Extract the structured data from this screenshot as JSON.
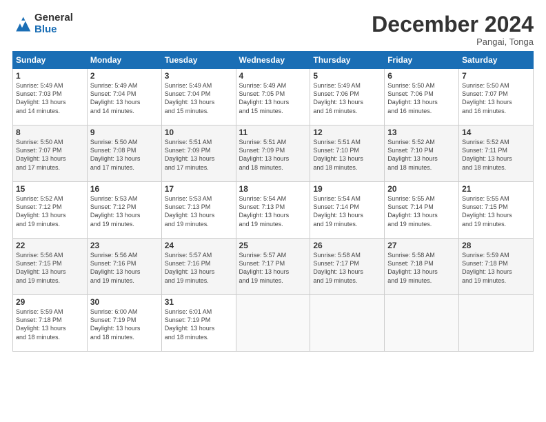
{
  "logo": {
    "general": "General",
    "blue": "Blue"
  },
  "title": "December 2024",
  "location": "Pangai, Tonga",
  "days_of_week": [
    "Sunday",
    "Monday",
    "Tuesday",
    "Wednesday",
    "Thursday",
    "Friday",
    "Saturday"
  ],
  "weeks": [
    [
      {
        "day": "1",
        "info": "Sunrise: 5:49 AM\nSunset: 7:03 PM\nDaylight: 13 hours\nand 14 minutes."
      },
      {
        "day": "2",
        "info": "Sunrise: 5:49 AM\nSunset: 7:04 PM\nDaylight: 13 hours\nand 14 minutes."
      },
      {
        "day": "3",
        "info": "Sunrise: 5:49 AM\nSunset: 7:04 PM\nDaylight: 13 hours\nand 15 minutes."
      },
      {
        "day": "4",
        "info": "Sunrise: 5:49 AM\nSunset: 7:05 PM\nDaylight: 13 hours\nand 15 minutes."
      },
      {
        "day": "5",
        "info": "Sunrise: 5:49 AM\nSunset: 7:06 PM\nDaylight: 13 hours\nand 16 minutes."
      },
      {
        "day": "6",
        "info": "Sunrise: 5:50 AM\nSunset: 7:06 PM\nDaylight: 13 hours\nand 16 minutes."
      },
      {
        "day": "7",
        "info": "Sunrise: 5:50 AM\nSunset: 7:07 PM\nDaylight: 13 hours\nand 16 minutes."
      }
    ],
    [
      {
        "day": "8",
        "info": "Sunrise: 5:50 AM\nSunset: 7:07 PM\nDaylight: 13 hours\nand 17 minutes."
      },
      {
        "day": "9",
        "info": "Sunrise: 5:50 AM\nSunset: 7:08 PM\nDaylight: 13 hours\nand 17 minutes."
      },
      {
        "day": "10",
        "info": "Sunrise: 5:51 AM\nSunset: 7:09 PM\nDaylight: 13 hours\nand 17 minutes."
      },
      {
        "day": "11",
        "info": "Sunrise: 5:51 AM\nSunset: 7:09 PM\nDaylight: 13 hours\nand 18 minutes."
      },
      {
        "day": "12",
        "info": "Sunrise: 5:51 AM\nSunset: 7:10 PM\nDaylight: 13 hours\nand 18 minutes."
      },
      {
        "day": "13",
        "info": "Sunrise: 5:52 AM\nSunset: 7:10 PM\nDaylight: 13 hours\nand 18 minutes."
      },
      {
        "day": "14",
        "info": "Sunrise: 5:52 AM\nSunset: 7:11 PM\nDaylight: 13 hours\nand 18 minutes."
      }
    ],
    [
      {
        "day": "15",
        "info": "Sunrise: 5:52 AM\nSunset: 7:12 PM\nDaylight: 13 hours\nand 19 minutes."
      },
      {
        "day": "16",
        "info": "Sunrise: 5:53 AM\nSunset: 7:12 PM\nDaylight: 13 hours\nand 19 minutes."
      },
      {
        "day": "17",
        "info": "Sunrise: 5:53 AM\nSunset: 7:13 PM\nDaylight: 13 hours\nand 19 minutes."
      },
      {
        "day": "18",
        "info": "Sunrise: 5:54 AM\nSunset: 7:13 PM\nDaylight: 13 hours\nand 19 minutes."
      },
      {
        "day": "19",
        "info": "Sunrise: 5:54 AM\nSunset: 7:14 PM\nDaylight: 13 hours\nand 19 minutes."
      },
      {
        "day": "20",
        "info": "Sunrise: 5:55 AM\nSunset: 7:14 PM\nDaylight: 13 hours\nand 19 minutes."
      },
      {
        "day": "21",
        "info": "Sunrise: 5:55 AM\nSunset: 7:15 PM\nDaylight: 13 hours\nand 19 minutes."
      }
    ],
    [
      {
        "day": "22",
        "info": "Sunrise: 5:56 AM\nSunset: 7:15 PM\nDaylight: 13 hours\nand 19 minutes."
      },
      {
        "day": "23",
        "info": "Sunrise: 5:56 AM\nSunset: 7:16 PM\nDaylight: 13 hours\nand 19 minutes."
      },
      {
        "day": "24",
        "info": "Sunrise: 5:57 AM\nSunset: 7:16 PM\nDaylight: 13 hours\nand 19 minutes."
      },
      {
        "day": "25",
        "info": "Sunrise: 5:57 AM\nSunset: 7:17 PM\nDaylight: 13 hours\nand 19 minutes."
      },
      {
        "day": "26",
        "info": "Sunrise: 5:58 AM\nSunset: 7:17 PM\nDaylight: 13 hours\nand 19 minutes."
      },
      {
        "day": "27",
        "info": "Sunrise: 5:58 AM\nSunset: 7:18 PM\nDaylight: 13 hours\nand 19 minutes."
      },
      {
        "day": "28",
        "info": "Sunrise: 5:59 AM\nSunset: 7:18 PM\nDaylight: 13 hours\nand 19 minutes."
      }
    ],
    [
      {
        "day": "29",
        "info": "Sunrise: 5:59 AM\nSunset: 7:18 PM\nDaylight: 13 hours\nand 18 minutes."
      },
      {
        "day": "30",
        "info": "Sunrise: 6:00 AM\nSunset: 7:19 PM\nDaylight: 13 hours\nand 18 minutes."
      },
      {
        "day": "31",
        "info": "Sunrise: 6:01 AM\nSunset: 7:19 PM\nDaylight: 13 hours\nand 18 minutes."
      },
      {
        "day": "",
        "info": ""
      },
      {
        "day": "",
        "info": ""
      },
      {
        "day": "",
        "info": ""
      },
      {
        "day": "",
        "info": ""
      }
    ]
  ]
}
